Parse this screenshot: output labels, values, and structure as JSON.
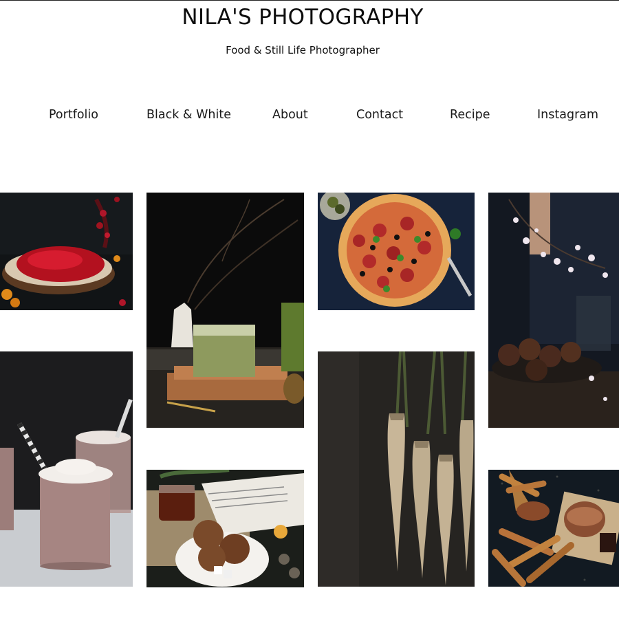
{
  "site": {
    "title": "NILA'S PHOTOGRAPHY",
    "tagline": "Food & Still Life Photographer"
  },
  "nav": {
    "portfolio": "Portfolio",
    "black_white": "Black & White",
    "about": "About",
    "contact": "Contact",
    "recipe": "Recipe",
    "instagram": "Instagram"
  },
  "gallery": {
    "photos": [
      "red-currants-on-wood-board",
      "matcha-latte-with-branches",
      "pepperoni-pizza-overhead",
      "blossoms-and-chocolate-muffins",
      "chocolate-milkshakes-with-straws",
      "tea-cookies-and-book",
      "parsnips-on-dark-wood",
      "churros-with-chocolate-dip"
    ]
  },
  "colors": {
    "background": "#ffffff",
    "text": "#111111"
  }
}
